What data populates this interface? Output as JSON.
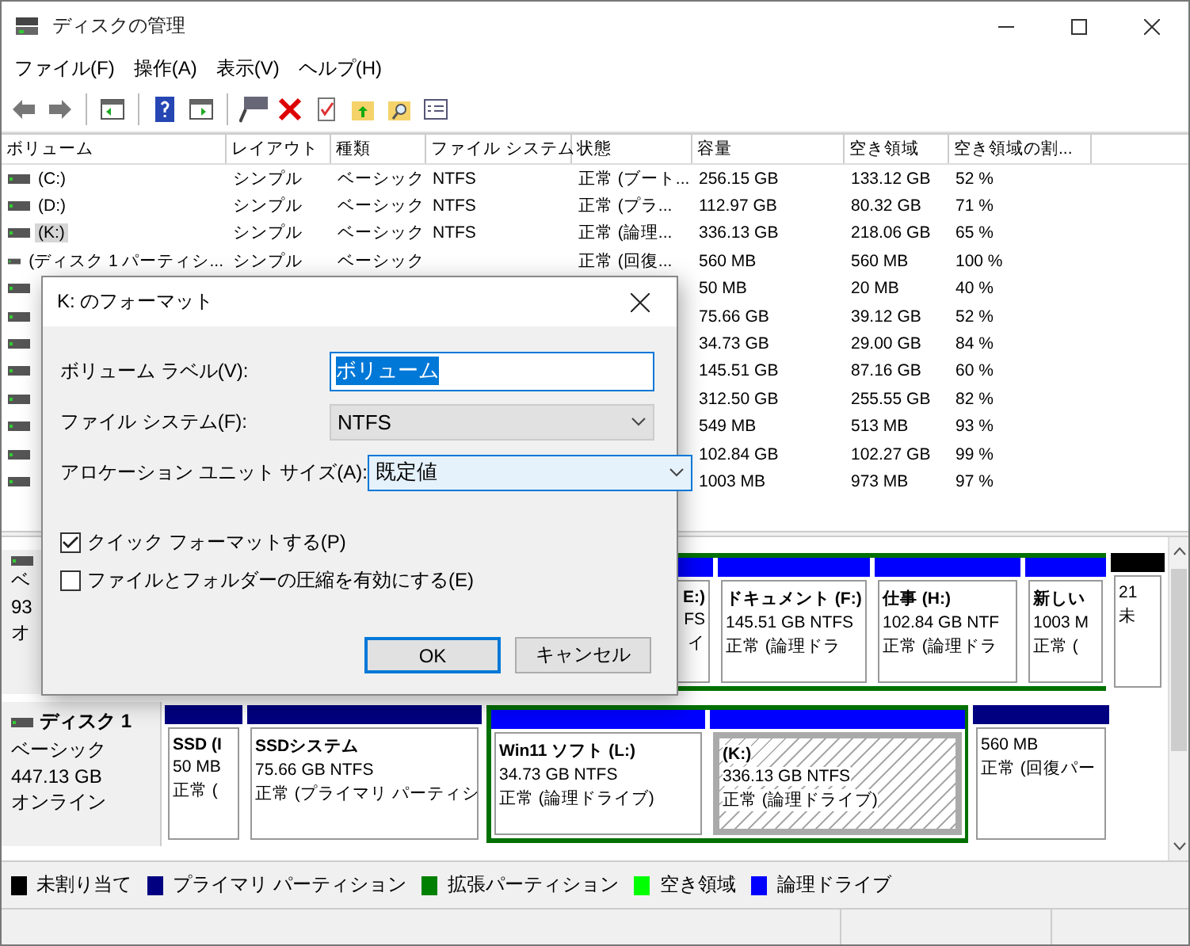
{
  "window": {
    "title": "ディスクの管理"
  },
  "menu": [
    "ファイル(F)",
    "操作(A)",
    "表示(V)",
    "ヘルプ(H)"
  ],
  "table": {
    "columns": [
      "ボリューム",
      "レイアウト",
      "種類",
      "ファイル システム",
      "状態",
      "容量",
      "空き領域",
      "空き領域の割..."
    ],
    "rows": [
      {
        "volume": "(C:)",
        "layout": "シンプル",
        "type": "ベーシック",
        "fs": "NTFS",
        "status": "正常 (ブート...",
        "capacity": "256.15 GB",
        "free": "133.12 GB",
        "percent": "52 %",
        "selected": false
      },
      {
        "volume": "(D:)",
        "layout": "シンプル",
        "type": "ベーシック",
        "fs": "NTFS",
        "status": "正常 (プラ...",
        "capacity": "112.97 GB",
        "free": "80.32 GB",
        "percent": "71 %",
        "selected": false
      },
      {
        "volume": "(K:)",
        "layout": "シンプル",
        "type": "ベーシック",
        "fs": "NTFS",
        "status": "正常 (論理...",
        "capacity": "336.13 GB",
        "free": "218.06 GB",
        "percent": "65 %",
        "selected": true
      },
      {
        "volume": "(ディスク 1 パーティシ...",
        "layout": "シンプル",
        "type": "ベーシック",
        "status": "正常 (回復...",
        "capacity": "560 MB",
        "free": "560 MB",
        "percent": "100 %",
        "selected": false
      },
      {
        "capacity": "50 MB",
        "free": "20 MB",
        "percent": "40 %"
      },
      {
        "capacity": "75.66 GB",
        "free": "39.12 GB",
        "percent": "52 %"
      },
      {
        "capacity": "34.73 GB",
        "free": "29.00 GB",
        "percent": "84 %"
      },
      {
        "capacity": "145.51 GB",
        "free": "87.16 GB",
        "percent": "60 %"
      },
      {
        "capacity": "312.50 GB",
        "free": "255.55 GB",
        "percent": "82 %"
      },
      {
        "capacity": "549 MB",
        "free": "513 MB",
        "percent": "93 %"
      },
      {
        "capacity": "102.84 GB",
        "free": "102.27 GB",
        "percent": "99 %"
      },
      {
        "capacity": "1003 MB",
        "free": "973 MB",
        "percent": "97 %"
      }
    ]
  },
  "disks": [
    {
      "lines": [
        "ベ",
        "93",
        "オ"
      ],
      "partitions": [
        {
          "kind": "extended",
          "children": [
            {
              "kind": "logical",
              "name": "E:)",
              "size": "FS",
              "status": "イ",
              "selected": false
            },
            {
              "kind": "logical",
              "name": "ドキュメント (F:)",
              "size": "145.51 GB NTFS",
              "status": "正常 (論理ドラ",
              "selected": false
            },
            {
              "kind": "logical",
              "name": "仕事 (H:)",
              "size": "102.84 GB NTF",
              "status": "正常 (論理ドラ",
              "selected": false
            },
            {
              "kind": "logical",
              "name": "新しい",
              "size": "1003 M",
              "status": "正常 (",
              "selected": false
            }
          ]
        },
        {
          "kind": "unallocated",
          "size": "21",
          "status": "未"
        }
      ]
    },
    {
      "name": "ディスク 1",
      "lines": [
        "ベーシック",
        "447.13 GB",
        "オンライン"
      ],
      "partitions": [
        {
          "kind": "primary",
          "name": "SSD (I",
          "size": "50 MB",
          "status": "正常 (",
          "selected": false
        },
        {
          "kind": "primary",
          "name": "SSDシステム",
          "size": "75.66 GB NTFS",
          "status": "正常 (プライマリ パーティシ",
          "selected": false
        },
        {
          "kind": "extended",
          "children": [
            {
              "kind": "logical",
              "name": "Win11 ソフト (L:)",
              "size": "34.73 GB NTFS",
              "status": "正常 (論理ドライブ)",
              "selected": false
            },
            {
              "kind": "logical",
              "name": " (K:)",
              "size": "336.13 GB NTFS",
              "status": "正常 (論理ドライブ)",
              "selected": true
            }
          ]
        },
        {
          "kind": "primary",
          "size": "560 MB",
          "status": "正常 (回復パー",
          "selected": false
        }
      ]
    }
  ],
  "legend": [
    {
      "label": "未割り当て",
      "color": "#000000"
    },
    {
      "label": "プライマリ パーティション",
      "color": "#000080"
    },
    {
      "label": "拡張パーティション",
      "color": "#008000"
    },
    {
      "label": "空き領域",
      "color": "#00ff00"
    },
    {
      "label": "論理ドライブ",
      "color": "#0000ff"
    }
  ],
  "dialog": {
    "title": "K: のフォーマット",
    "fields": [
      {
        "kind": "text",
        "label": "ボリューム ラベル(V):",
        "value": "ボリューム",
        "disabled": false
      },
      {
        "kind": "select",
        "label": "ファイル システム(F):",
        "value": "NTFS",
        "disabled": true
      },
      {
        "kind": "select",
        "label": "アロケーション ユニット サイズ(A):",
        "value": "既定値",
        "disabled": false
      }
    ],
    "options": [
      {
        "label": "クイック フォーマットする(P)",
        "checked": true
      },
      {
        "label": "ファイルとフォルダーの圧縮を有効にする(E)",
        "checked": false
      }
    ],
    "buttons": [
      {
        "label": "OK",
        "default": true
      },
      {
        "label": "キャンセル",
        "default": false
      }
    ]
  }
}
